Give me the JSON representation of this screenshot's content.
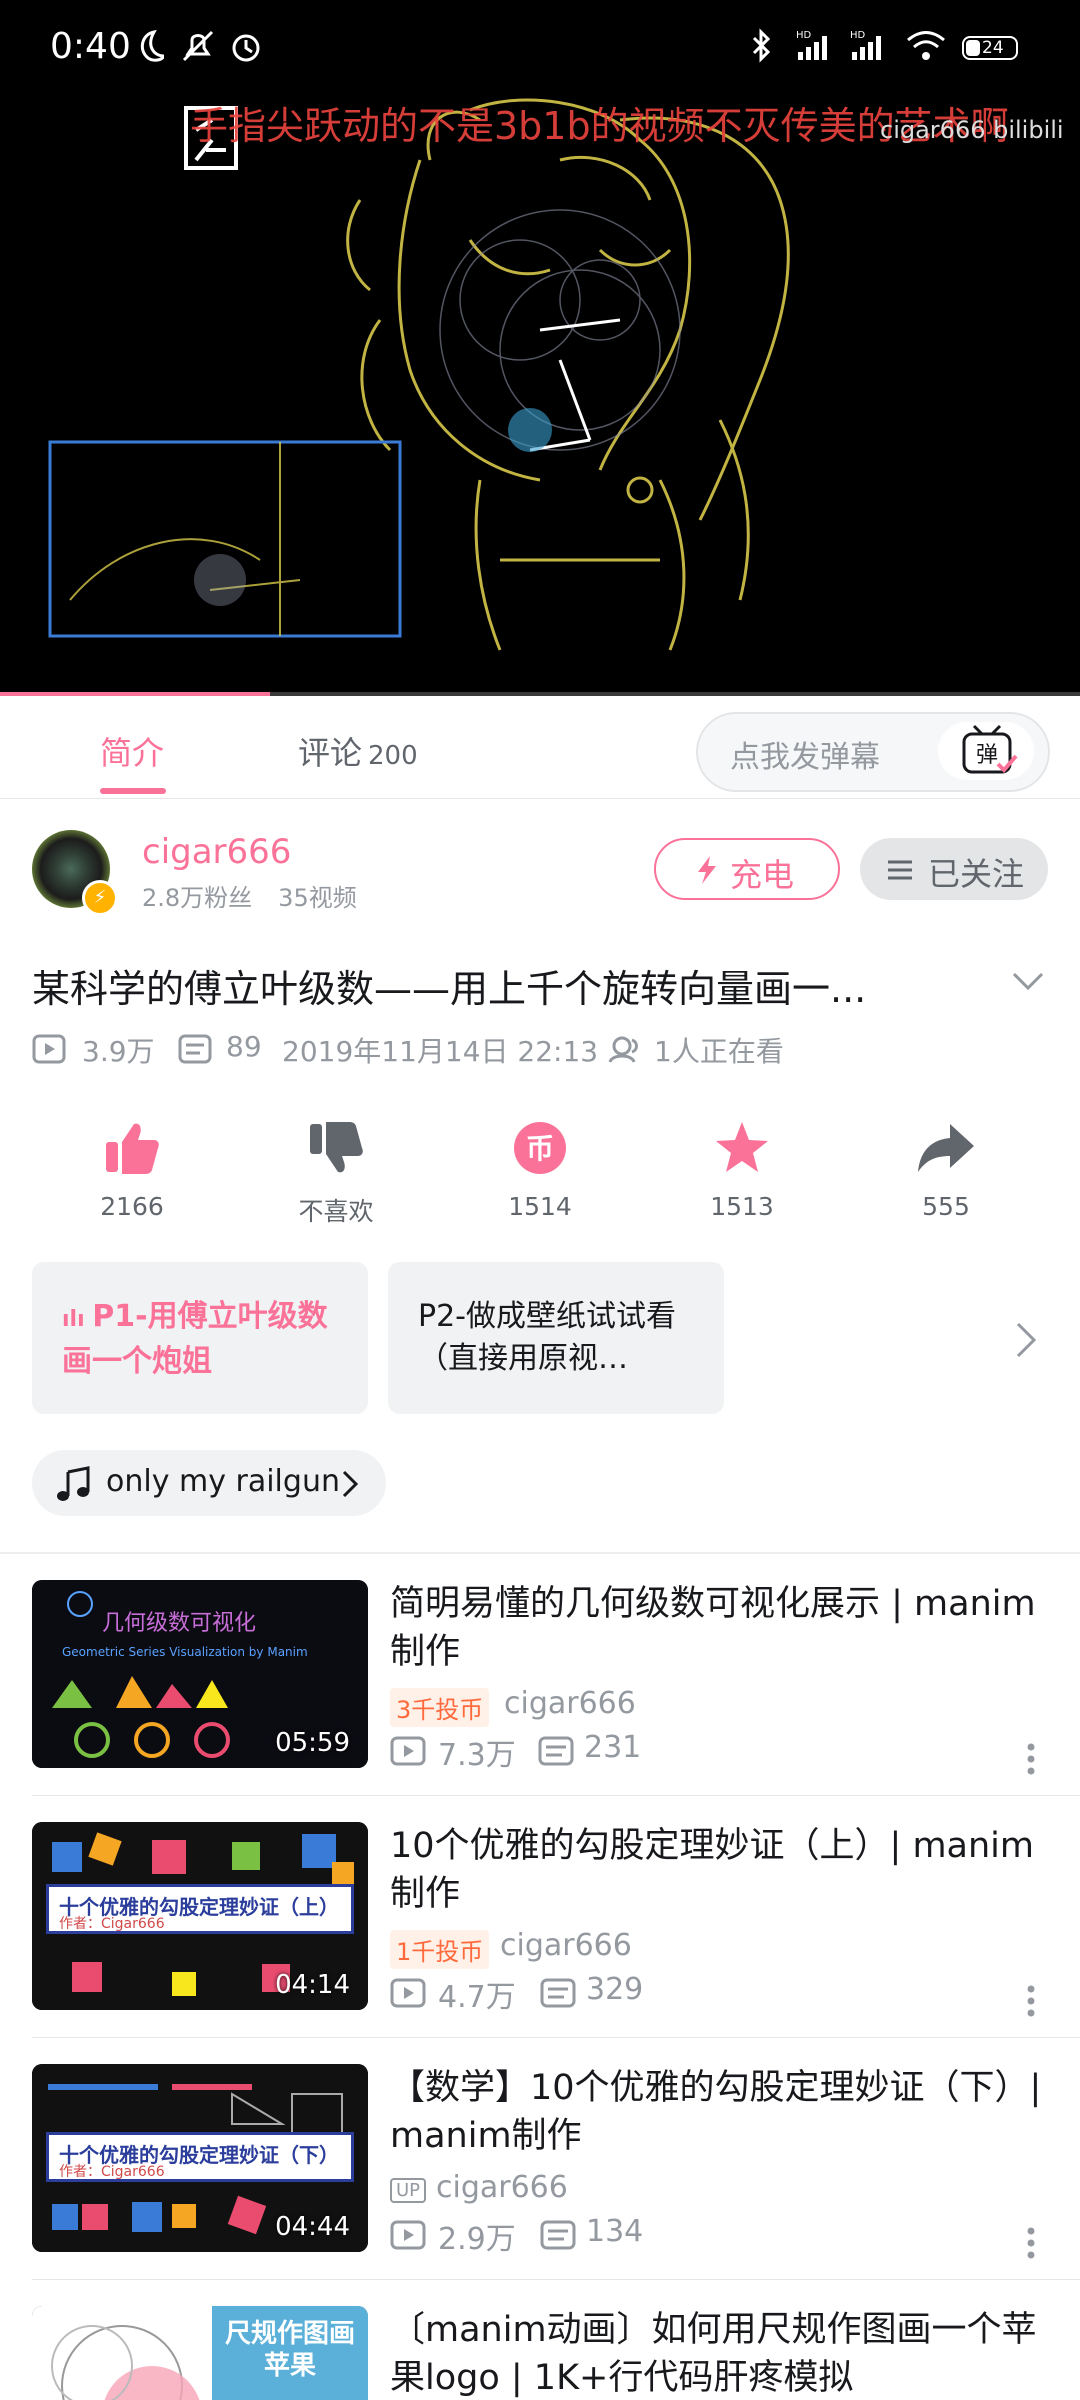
{
  "status_bar": {
    "time": "0:40",
    "battery": "24"
  },
  "player": {
    "danmaku_text": "手指尖跃动的不是3b1b的视频不灭传美的艺术啊",
    "watermark": "cigar666 bilibili",
    "progress": 0.25
  },
  "tabs": {
    "intro": "简介",
    "comments": "评论",
    "comments_count": "200",
    "danmaku_placeholder": "点我发弹幕",
    "danmaku_toggle": "弹"
  },
  "uploader": {
    "name": "cigar666",
    "fans": "2.8万粉丝",
    "videos": "35视频",
    "charge_label": "充电",
    "follow_label": "已关注"
  },
  "video": {
    "title": "某科学的傅立叶级数——用上千个旋转向量画一...",
    "views": "3.9万",
    "danmaku_count": "89",
    "date": "2019年11月14日 22:13",
    "watching": "1人正在看"
  },
  "actions": {
    "like": "2166",
    "dislike": "不喜欢",
    "coin": "1514",
    "favorite": "1513",
    "share": "555"
  },
  "parts": [
    {
      "label": "P1-用傅立叶级数画一个炮姐"
    },
    {
      "label": "P2-做成壁纸试试看（直接用原视…"
    }
  ],
  "music": {
    "title": "only my railgun"
  },
  "recommendations": [
    {
      "title": "简明易懂的几何级数可视化展示 | manim制作",
      "badge": "3千投币",
      "author": "cigar666",
      "views": "7.3万",
      "danmaku": "231",
      "duration": "05:59",
      "thumb_text": "几何级数可视化",
      "thumb_sub": "Geometric Series Visualization by Manim"
    },
    {
      "title": "10个优雅的勾股定理妙证（上）| manim制作",
      "badge": "1千投币",
      "author": "cigar666",
      "views": "4.7万",
      "danmaku": "329",
      "duration": "04:14",
      "thumb_text": "十个优雅的勾股定理妙证（上）",
      "thumb_sub": "作者：Cigar666"
    },
    {
      "title": "【数学】10个优雅的勾股定理妙证（下）| manim制作",
      "badge": "UP",
      "author": "cigar666",
      "views": "2.9万",
      "danmaku": "134",
      "duration": "04:44",
      "thumb_text": "十个优雅的勾股定理妙证（下）",
      "thumb_sub": "作者：Cigar666"
    },
    {
      "title": "〔manim动画〕如何用尺规作图画一个苹果logo | 1K+行代码肝疼模拟",
      "thumb_text": "尺规作图画苹果"
    }
  ],
  "colors": {
    "accent": "#fb7299",
    "muted": "#9499a0",
    "coin_badge": "#ff6a3d"
  }
}
